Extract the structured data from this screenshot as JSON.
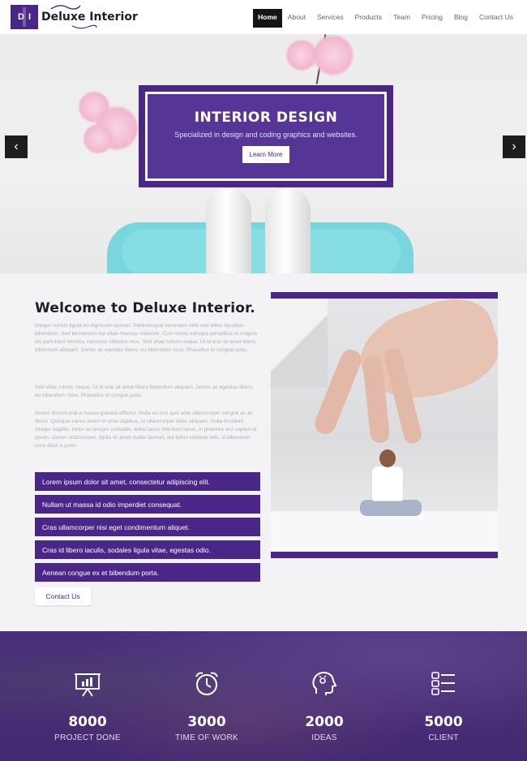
{
  "brand": {
    "initials_left": "D",
    "initials_right": "I",
    "name": "Deluxe Interior",
    "accent_color": "#4a2689"
  },
  "nav": {
    "items": [
      {
        "label": "Home",
        "active": true
      },
      {
        "label": "About",
        "active": false
      },
      {
        "label": "Services",
        "active": false
      },
      {
        "label": "Products",
        "active": false
      },
      {
        "label": "Team",
        "active": false
      },
      {
        "label": "Pricing",
        "active": false
      },
      {
        "label": "Blog",
        "active": false
      },
      {
        "label": "Contact Us",
        "active": false
      }
    ]
  },
  "hero": {
    "title": "INTERIOR DESIGN",
    "subtitle": "Specialized in design and coding graphics and websites.",
    "button_label": "Learn More",
    "prev_arrow": "‹",
    "next_arrow": "›"
  },
  "welcome": {
    "title": "Welcome to Deluxe Interior.",
    "para1": "Integer rutrum ligula eu dignissim laoreet. Pellentesque venenatis nibh sed tellus faucibus bibendum. Sed fermentum est vitae rhoncus molestie. Cum sociis natoque penatibus et magnis dis parturient montes, nascetur ridiculus mus. Sed vitae rutrum neque. Ut id erat sit amet libero bibendum aliquam. Donec ac egestas libero, eu bibendum risus. Phasellus et congue justo.",
    "para2": "Sed vitae rutrum neque. Ut id erat sit amet libero bibendum aliquam. Donec ac egestas libero, eu bibendum risus. Phasellus et congue justo.",
    "para3": "Donec dictum erat a massa gravida efficitur. Nulla eu orci quis ante ullamcorper congue ac ac libero. Quisque varius lorem in urna dapibus, ut ullamcorper dolor aliquam. Nulla tincidunt integer sagittis, tortor eu tempor convallis, tellus lacus interdum lacus, in pharetra orci sapien id ipsum. Donec ullamcorper, ligula sit amet mattis laoreet, dui tellus volutpat felis, id bibendum urna diam a justo.",
    "list": [
      "Lorem ipsum dolor sit amet, consectetur adipiscing elit.",
      "Nullam ut massa id odio imperdiet consequat.",
      "Cras ullamcorper nisi eget condimentum aliquet.",
      "Cras id libero iaculis, sodales ligula vitae, egestas odio.",
      "Aenean congue ex et bibendum porta."
    ],
    "contact_button": "Contact Us"
  },
  "stats": [
    {
      "icon": "presentation-chart-icon",
      "number": "8000",
      "label": "PROJECT DONE"
    },
    {
      "icon": "alarm-clock-icon",
      "number": "3000",
      "label": "TIME OF WORK"
    },
    {
      "icon": "head-ideas-icon",
      "number": "2000",
      "label": "IDEAS"
    },
    {
      "icon": "checklist-icon",
      "number": "5000",
      "label": "CLIENT"
    }
  ]
}
